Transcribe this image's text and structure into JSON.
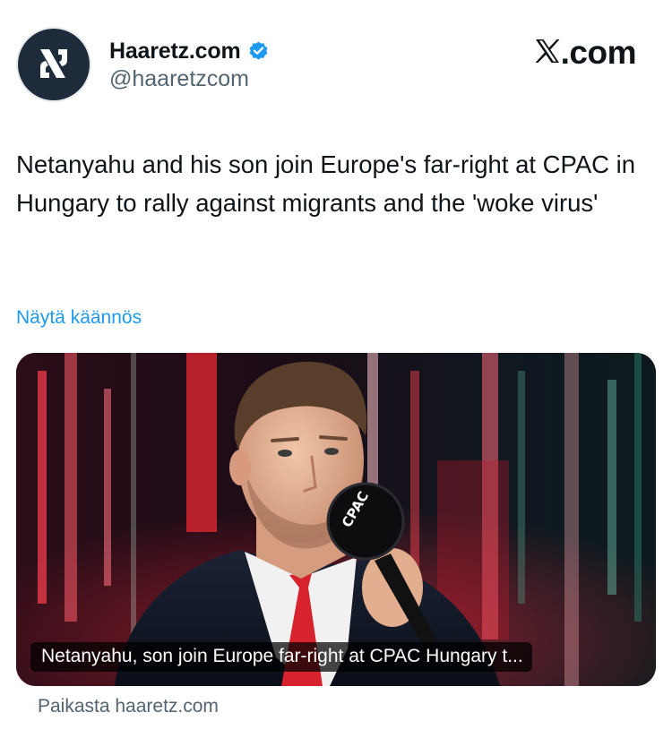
{
  "account": {
    "display_name": "Haaretz.com",
    "handle": "@haaretzcom",
    "verified": true,
    "avatar_icon": "haaretz-logo-icon"
  },
  "brand": {
    "label": ".com",
    "icon": "x-logo-icon"
  },
  "tweet": {
    "text": "Netanyahu and his son join Europe's far-right at CPAC in Hungary to rally against migrants and the 'woke virus'",
    "translate_label": "Näytä käännös"
  },
  "card": {
    "caption": "Netanyahu, son join Europe far-right at CPAC Hungary t...",
    "image_icon": "man-speaking-microphone-image",
    "mic_label": "CPAC"
  },
  "source_label": "Paikasta haaretz.com",
  "colors": {
    "link": "#1d9bf0",
    "secondary_text": "#536471",
    "verified_badge": "#1d9bf0",
    "avatar_bg": "#1d2b3b"
  }
}
